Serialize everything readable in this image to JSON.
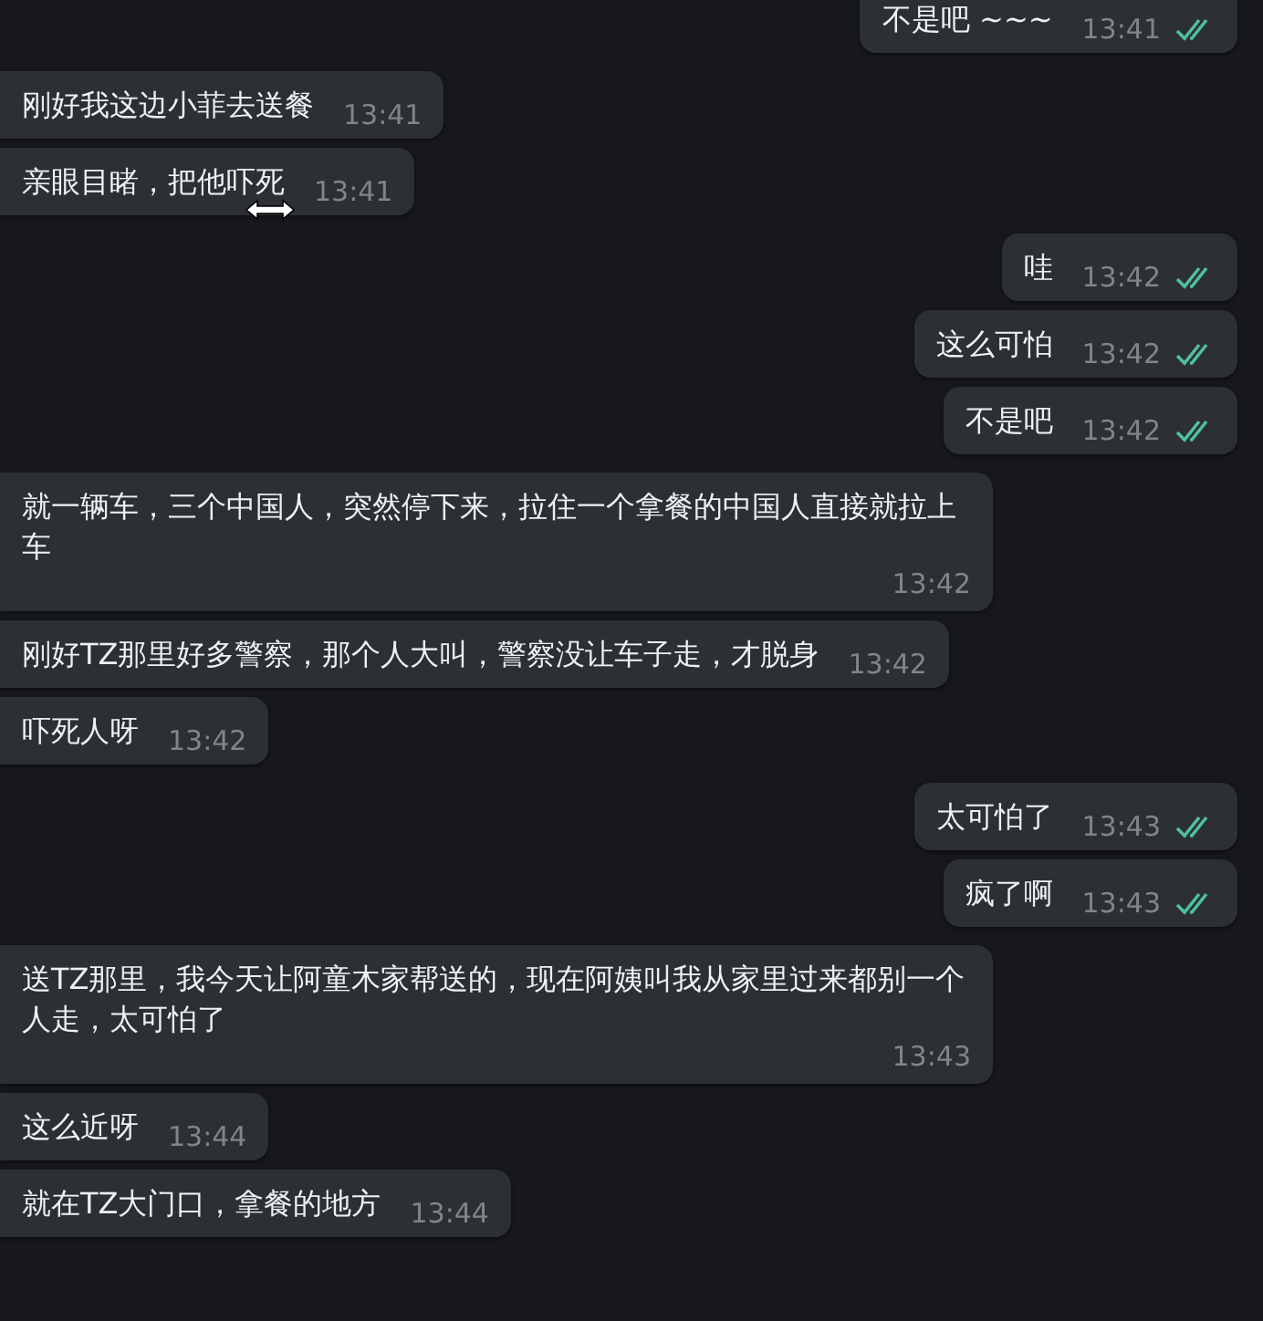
{
  "messages": [
    {
      "kind": "outgoing",
      "text": "不是吧 ~~~",
      "time": "13:41",
      "read": true
    },
    {
      "kind": "incoming",
      "text": "刚好我这边小菲去送餐",
      "time": "13:41"
    },
    {
      "kind": "incoming",
      "text": "亲眼目睹，把他吓死",
      "time": "13:41",
      "cursor_over": true
    },
    {
      "kind": "outgoing",
      "text": "哇",
      "time": "13:42",
      "read": true
    },
    {
      "kind": "outgoing",
      "text": "这么可怕",
      "time": "13:42",
      "read": true
    },
    {
      "kind": "outgoing",
      "text": "不是吧",
      "time": "13:42",
      "read": true
    },
    {
      "kind": "incoming",
      "text": "就一辆车，三个中国人，突然停下来，拉住一个拿餐的中国人直接就拉上车",
      "time": "13:42"
    },
    {
      "kind": "incoming",
      "text": "刚好TZ那里好多警察，那个人大叫，警察没让车子走，才脱身",
      "time": "13:42"
    },
    {
      "kind": "incoming",
      "text": "吓死人呀",
      "time": "13:42"
    },
    {
      "kind": "outgoing",
      "text": "太可怕了",
      "time": "13:43",
      "read": true
    },
    {
      "kind": "outgoing",
      "text": "疯了啊",
      "time": "13:43",
      "read": true
    },
    {
      "kind": "incoming",
      "text": "送TZ那里，我今天让阿童木家帮送的，现在阿姨叫我从家里过来都别一个人走，太可怕了",
      "time": "13:43"
    },
    {
      "kind": "incoming",
      "text": "这么近呀",
      "time": "13:44"
    },
    {
      "kind": "incoming",
      "text": "就在TZ大门口，拿餐的地方",
      "time": "13:44"
    }
  ]
}
